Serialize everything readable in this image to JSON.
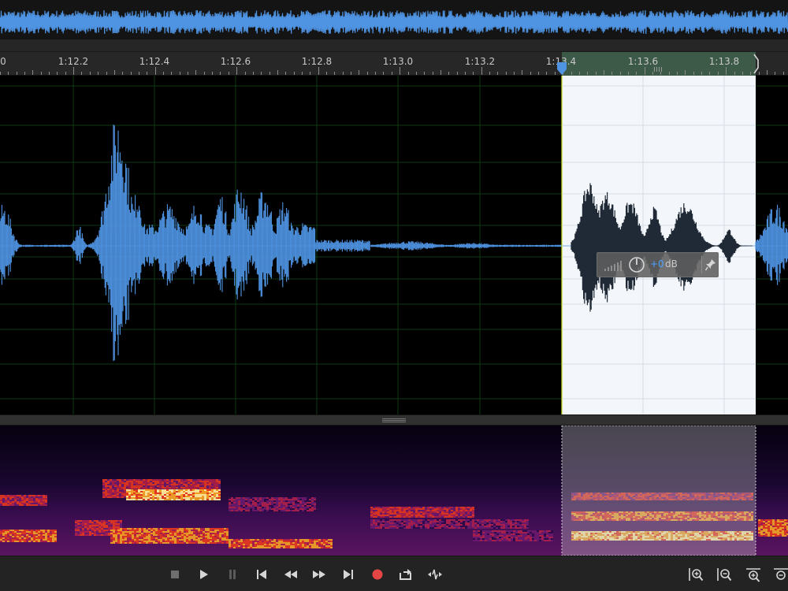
{
  "app": {
    "accent": "#4f94e3",
    "selection_color": "#f3f6fb",
    "record_color": "#e64545"
  },
  "ruler": {
    "labels": [
      "0",
      "1:12.2",
      "1:12.4",
      "1:12.6",
      "1:12.8",
      "1:13.0",
      "1:13.2",
      "1:13.4",
      "1:13.6",
      "1:13.8"
    ]
  },
  "hud": {
    "gain_value": "+0",
    "gain_unit": "dB"
  },
  "transport": {
    "buttons": [
      {
        "name": "stop-button",
        "icon": "stop-icon"
      },
      {
        "name": "play-button",
        "icon": "play-icon"
      },
      {
        "name": "pause-button",
        "icon": "pause-icon"
      },
      {
        "name": "go-to-start-button",
        "icon": "skip-back-icon"
      },
      {
        "name": "rewind-button",
        "icon": "rewind-icon"
      },
      {
        "name": "fast-forward-button",
        "icon": "fast-forward-icon"
      },
      {
        "name": "go-to-end-button",
        "icon": "skip-forward-icon"
      },
      {
        "name": "record-button",
        "icon": "record-icon"
      },
      {
        "name": "loop-playback-button",
        "icon": "loop-icon"
      },
      {
        "name": "skip-selection-button",
        "icon": "skip-selection-icon"
      }
    ],
    "zoom_buttons": [
      {
        "name": "zoom-in-amplitude-button",
        "icon": "zoom-in-amplitude-icon"
      },
      {
        "name": "zoom-out-amplitude-button",
        "icon": "zoom-out-amplitude-icon"
      },
      {
        "name": "zoom-in-time-button",
        "icon": "zoom-in-time-icon"
      },
      {
        "name": "zoom-out-time-button",
        "icon": "zoom-out-time-icon"
      }
    ]
  }
}
